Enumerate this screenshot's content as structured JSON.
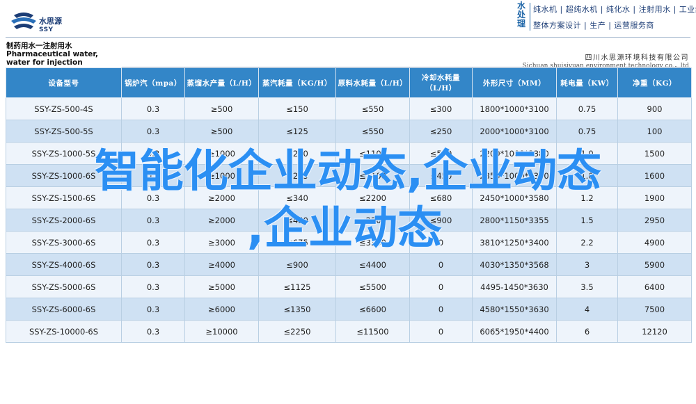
{
  "header": {
    "logo_cn": "水思源",
    "logo_en": "SSY",
    "brand_vertical": [
      "水",
      "处",
      "理"
    ],
    "slogan_line1": "纯水机 | 超纯水机 | 纯化水 | 注射用水 | 工业纯水设备",
    "slogan_line2": "整体方案设计 | 生产 | 运营服务商",
    "accent_color": "#1a63a6"
  },
  "company": {
    "name_cn": "四川水思源环境科技有限公司",
    "name_en": "Sichuan shuisiyuan environment technology co.，ltd"
  },
  "product_title": "制药用水一注射用水 Pharmaceutical water, water for injection",
  "table": {
    "header_color": "#3386c8",
    "columns": [
      "设备型号",
      "锅炉汽（mpa）",
      "蒸馏水产量（L/H）",
      "蒸汽耗量（KG/H）",
      "原料水耗量（L/H）",
      "冷却水耗量（L/H）",
      "外形尺寸（MM）",
      "耗电量（KW）",
      "净重（KG）"
    ],
    "rows": [
      [
        "SSY-ZS-500-4S",
        "0.3",
        "≥500",
        "≤150",
        "≤550",
        "≤300",
        "1800*1000*3100",
        "0.75",
        "900"
      ],
      [
        "SSY-ZS-500-5S",
        "0.3",
        "≥500",
        "≤125",
        "≤550",
        "≤250",
        "2000*1000*3100",
        "0.75",
        "100"
      ],
      [
        "SSY-ZS-1000-5S",
        "0.3",
        "≥1000",
        "≤250",
        "≤1100",
        "≤500",
        "2200*1000*3380",
        "1.0",
        "1500"
      ],
      [
        "SSY-ZS-1000-6S",
        "0.3",
        "≥1000",
        "≤225",
        "≤1100",
        "≤450",
        "2350*1000*3380",
        "1.0",
        "1600"
      ],
      [
        "SSY-ZS-1500-6S",
        "0.3",
        "≥2000",
        "≤340",
        "≤2200",
        "≤680",
        "2450*1000*3580",
        "1.2",
        "1900"
      ],
      [
        "SSY-ZS-2000-6S",
        "0.3",
        "≥2000",
        "≤450",
        "≤2200",
        "≤900",
        "2800*1150*3355",
        "1.5",
        "2950"
      ],
      [
        "SSY-ZS-3000-6S",
        "0.3",
        "≥3000",
        "≤675",
        "≤3300",
        "0",
        "3810*1250*3400",
        "2.2",
        "4900"
      ],
      [
        "SSY-ZS-4000-6S",
        "0.3",
        "≥4000",
        "≤900",
        "≤4400",
        "0",
        "4030*1350*3568",
        "3",
        "5900"
      ],
      [
        "SSY-ZS-5000-6S",
        "0.3",
        "≥5000",
        "≤1125",
        "≤5500",
        "0",
        "4495-1450*3630",
        "3.5",
        "6400"
      ],
      [
        "SSY-ZS-6000-6S",
        "0.3",
        "≥6000",
        "≤1350",
        "≤6600",
        "0",
        "4580*1550*3630",
        "4",
        "7500"
      ],
      [
        "SSY-ZS-10000-6S",
        "0.3",
        "≥10000",
        "≤2250",
        "≤11500",
        "0",
        "6065*1950*4400",
        "6",
        "12120"
      ]
    ]
  },
  "overlay": {
    "line1": "智能化企业动态,企业动态",
    "line2": ",企业动态",
    "color": "#2b8ff3"
  }
}
